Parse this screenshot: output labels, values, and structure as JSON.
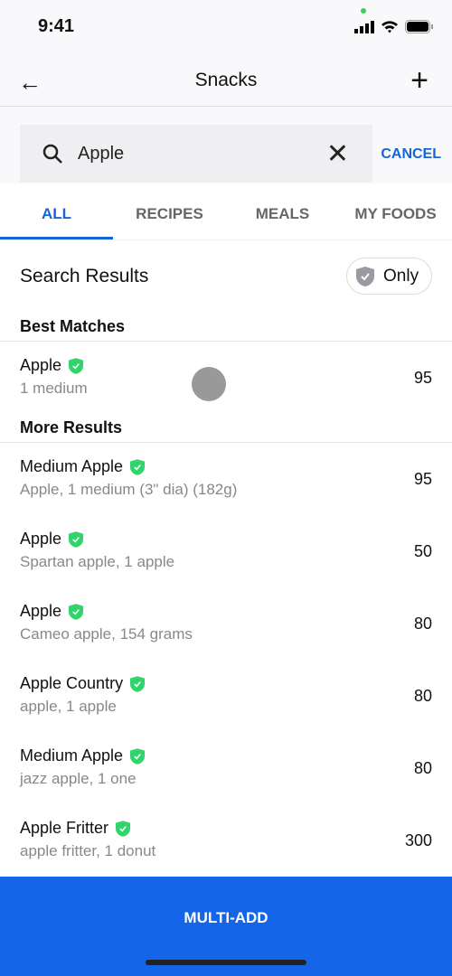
{
  "status": {
    "time": "9:41"
  },
  "nav": {
    "title": "Snacks"
  },
  "search": {
    "value": "Apple",
    "cancel": "CANCEL"
  },
  "tabs": [
    {
      "label": "ALL"
    },
    {
      "label": "RECIPES"
    },
    {
      "label": "MEALS"
    },
    {
      "label": "MY FOODS"
    }
  ],
  "results": {
    "heading": "Search Results",
    "only": "Only",
    "best": "Best Matches",
    "more": "More Results"
  },
  "best_matches": [
    {
      "name": "Apple",
      "desc": "1 medium",
      "cal": "95"
    }
  ],
  "more_results": [
    {
      "name": "Medium Apple",
      "desc": "Apple, 1 medium (3\" dia) (182g)",
      "cal": "95"
    },
    {
      "name": "Apple",
      "desc": "Spartan apple, 1 apple",
      "cal": "50"
    },
    {
      "name": "Apple",
      "desc": "Cameo apple, 154 grams",
      "cal": "80"
    },
    {
      "name": "Apple Country",
      "desc": "apple, 1 apple",
      "cal": "80"
    },
    {
      "name": "Medium Apple",
      "desc": "jazz apple, 1 one",
      "cal": "80"
    },
    {
      "name": "Apple Fritter",
      "desc": "apple fritter, 1 donut",
      "cal": "300"
    }
  ],
  "footer": {
    "multi_add": "MULTI-ADD"
  },
  "colors": {
    "accent": "#1565e8",
    "verified": "#2fd46b"
  }
}
